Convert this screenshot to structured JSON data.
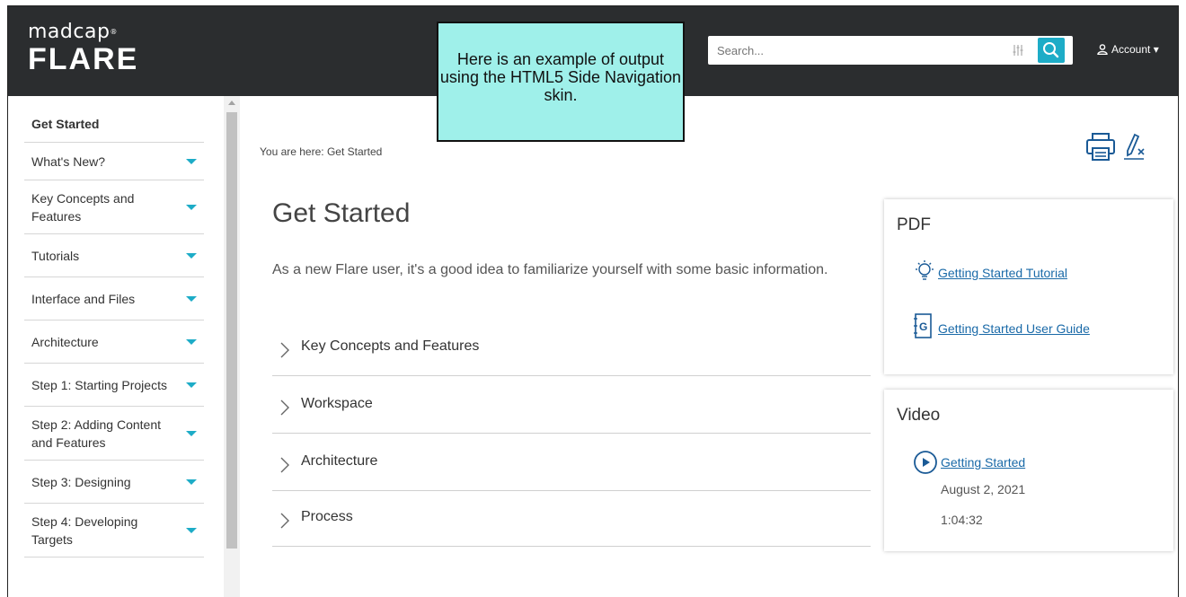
{
  "header": {
    "logo_top": "madcap",
    "logo_bottom": "FLARE",
    "search_placeholder": "Search...",
    "account_label": "Account ▾"
  },
  "tooltip": "Here is an example of output using the HTML5 Side Navigation skin.",
  "sidebar": {
    "items": [
      {
        "label": "Get Started",
        "has_caret": false,
        "bold": true
      },
      {
        "label": "What's New?",
        "has_caret": true
      },
      {
        "label": "Key Concepts and Features",
        "has_caret": true
      },
      {
        "label": "Tutorials",
        "has_caret": true
      },
      {
        "label": "Interface and Files",
        "has_caret": true
      },
      {
        "label": "Architecture",
        "has_caret": true
      },
      {
        "label": "Step 1: Starting Projects",
        "has_caret": true
      },
      {
        "label": "Step 2: Adding Content and Features",
        "has_caret": true
      },
      {
        "label": "Step 3: Designing",
        "has_caret": true
      },
      {
        "label": "Step 4: Developing Targets",
        "has_caret": true
      }
    ]
  },
  "main": {
    "breadcrumb": "You are here: Get Started",
    "title": "Get Started",
    "intro": "As a new Flare user, it's a good idea to familiarize yourself with some basic information.",
    "dropdowns": [
      "Key Concepts and Features",
      "Workspace",
      "Architecture",
      "Process"
    ]
  },
  "pdf_card": {
    "title": "PDF",
    "links": [
      "Getting Started Tutorial",
      "Getting Started User Guide"
    ]
  },
  "video_card": {
    "title": "Video",
    "link": "Getting Started",
    "date": "August 2, 2021",
    "duration": "1:04:32"
  },
  "colors": {
    "header_bg": "#2b2d2f",
    "accent": "#1dacc7",
    "tooltip_bg": "#9ff0ea",
    "link": "#1a6aa8"
  }
}
